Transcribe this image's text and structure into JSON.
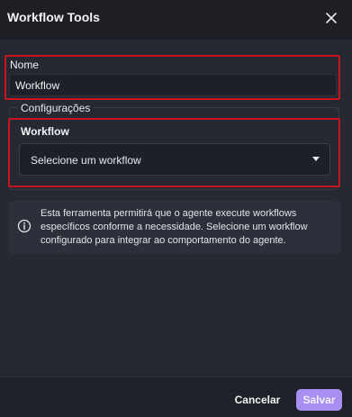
{
  "dialog": {
    "title": "Workflow Tools",
    "close_icon": "close-icon"
  },
  "form": {
    "nome": {
      "label": "Nome",
      "value": "Workflow"
    },
    "configuracoes": {
      "legend": "Configurações",
      "workflow": {
        "label": "Workflow",
        "selected": "Selecione um workflow",
        "caret_icon": "caret-down-icon"
      }
    }
  },
  "info": {
    "icon": "info-circle-icon",
    "text": "Esta ferramenta permitirá que o agente execute workflows específicos conforme a necessidade. Selecione um workflow configurado para integrar ao comportamento do agente."
  },
  "footer": {
    "cancel_label": "Cancelar",
    "save_label": "Salvar"
  },
  "colors": {
    "highlight_border": "#c4161c",
    "save_button": "#a88ef0",
    "background": "#24262e"
  }
}
